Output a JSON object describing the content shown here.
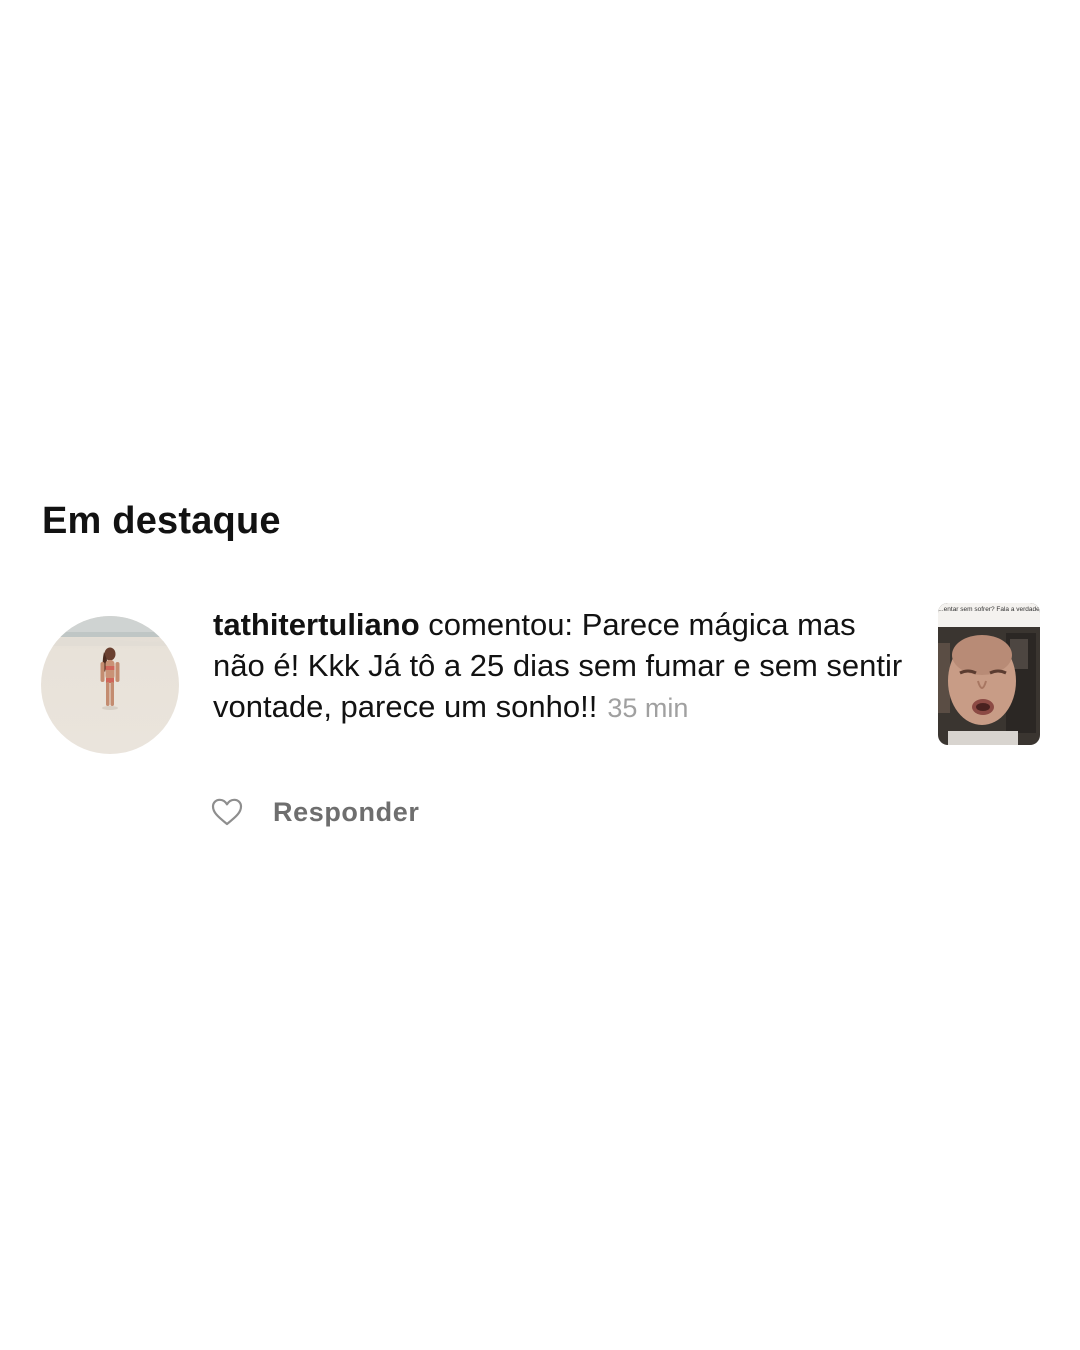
{
  "section": {
    "title": "Em destaque"
  },
  "comment": {
    "username": "tathitertuliano",
    "action": "comentou:",
    "text": "Parece mágica mas não é! Kkk Já tô a 25 dias sem fumar e sem sentir vontade, parece um sonho!!",
    "timestamp": "35 min",
    "avatar_icon": "profile-photo-beach",
    "post_thumbnail": {
      "icon": "video-thumbnail-man",
      "caption": "...entar sem sofrer? Fala a verdade"
    }
  },
  "actions": {
    "like_icon": "heart-outline-icon",
    "reply_label": "Responder"
  },
  "colors": {
    "text_primary": "#121212",
    "text_secondary": "#6e6e6e",
    "timestamp": "#a0a0a0",
    "background": "#ffffff"
  }
}
